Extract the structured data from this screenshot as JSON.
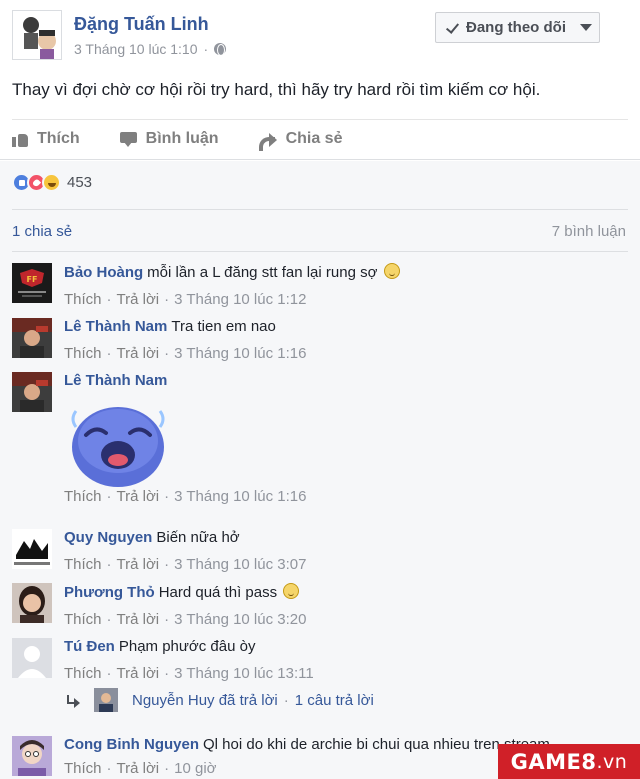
{
  "post": {
    "author": "Đặng Tuấn Linh",
    "timestamp": "3 Tháng 10 lúc 1:10",
    "privacy_icon": "globe-icon",
    "follow_label": "Đang theo dõi",
    "text": "Thay vì đợi chờ cơ hội rồi try hard, thì hãy try hard rồi tìm kiếm cơ hội."
  },
  "actions": {
    "like": "Thích",
    "comment": "Bình luận",
    "share": "Chia sẻ"
  },
  "stats": {
    "reaction_types": [
      "like",
      "love",
      "haha"
    ],
    "reaction_count": "453",
    "shares": "1 chia sẻ",
    "comments": "7 bình luận"
  },
  "comment_meta": {
    "like": "Thích",
    "reply": "Trả lời"
  },
  "comments": [
    {
      "name": "Bảo Hoàng",
      "text": "mỗi lần a L đăng stt fan lại rung sợ",
      "emoji": "smile-emoji",
      "time": "3 Tháng 10 lúc 1:12"
    },
    {
      "name": "Lê Thành Nam",
      "text": "Tra tien em nao",
      "time": "3 Tháng 10 lúc 1:16"
    },
    {
      "name": "Lê Thành Nam",
      "text": "",
      "sticker": "crying-blob-sticker",
      "time": "3 Tháng 10 lúc 1:16"
    },
    {
      "name": "Quy Nguyen",
      "text": "Biến nữa hở",
      "time": "3 Tháng 10 lúc 3:07"
    },
    {
      "name": "Phương Thỏ",
      "text": "Hard quá thì pass",
      "emoji": "smile-emoji",
      "time": "3 Tháng 10 lúc 3:20"
    },
    {
      "name": "Tú Đen",
      "text": "Phạm phước đâu òy",
      "time": "3 Tháng 10 lúc 13:11"
    },
    {
      "name": "Cong Binh Nguyen",
      "text": "Ql hoi do khi de archie bi chui qua nhieu tren stream",
      "time": "10 giờ"
    }
  ],
  "reply_summary": {
    "text": "Nguyễn Huy đã trả lời",
    "separator": "·",
    "count": "1 câu trả lời"
  },
  "watermark": {
    "brand": "GAME8",
    "suffix": ".vn"
  },
  "colors": {
    "link": "#365899",
    "meta": "#90949c",
    "background": "#f6f7f9",
    "watermark": "#d02028"
  }
}
